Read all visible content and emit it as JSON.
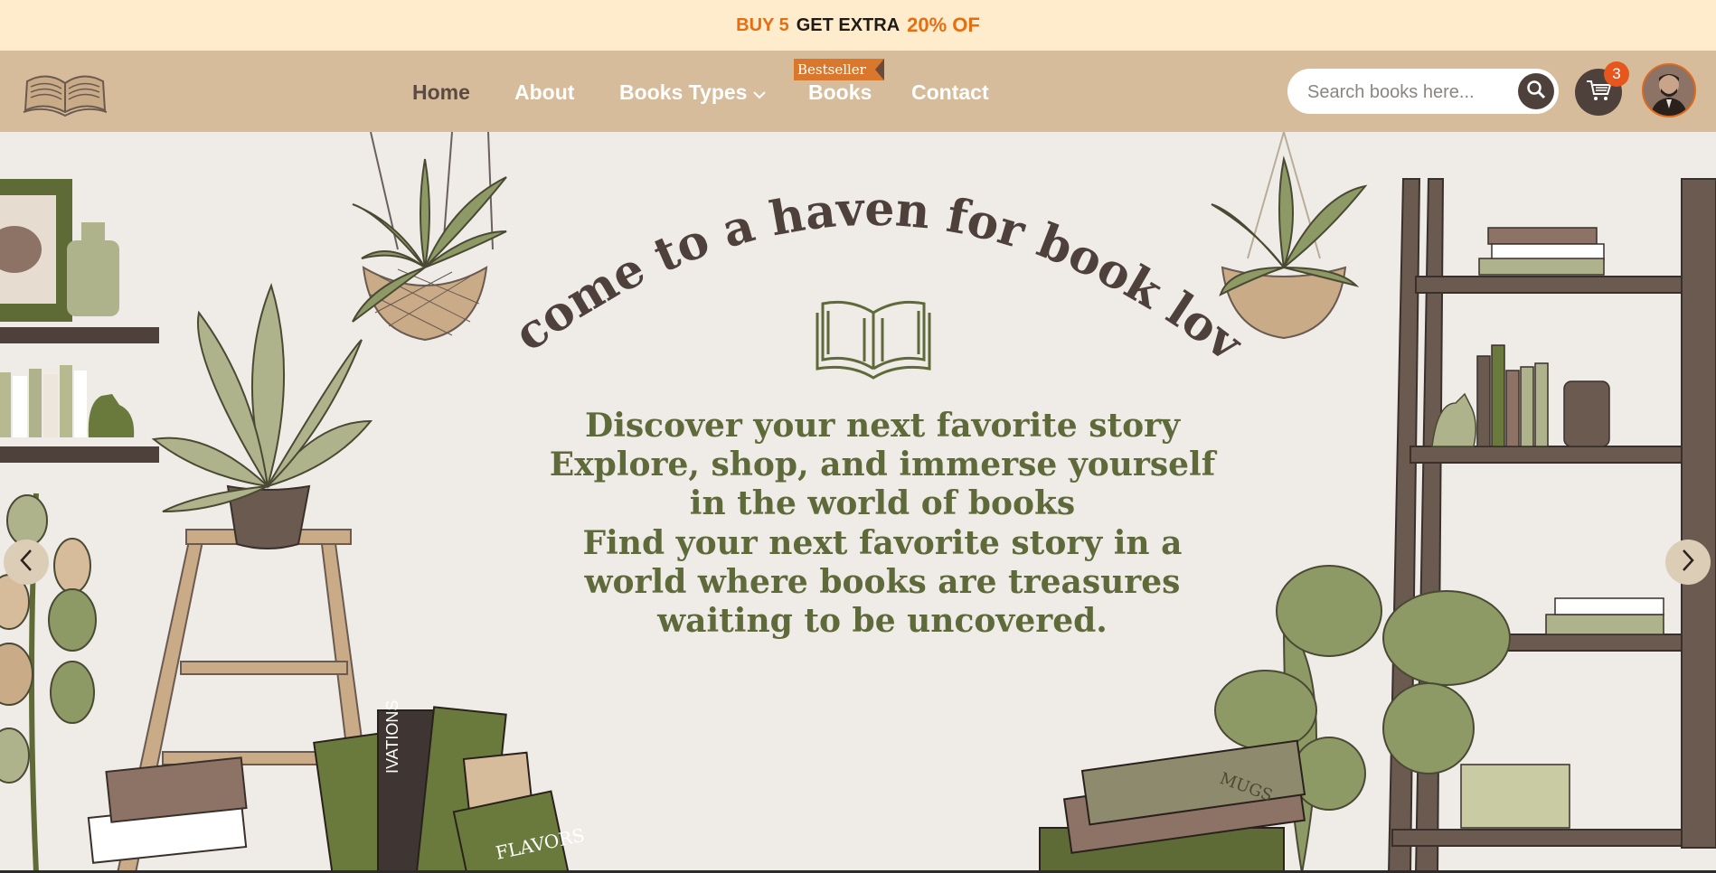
{
  "promo": {
    "part1": "BUY 5",
    "part2": "GET EXTRA",
    "part3": "20% OF"
  },
  "nav": {
    "items": [
      {
        "label": "Home"
      },
      {
        "label": "About"
      },
      {
        "label": "Books Types"
      },
      {
        "label": "Books"
      },
      {
        "label": "Contact"
      }
    ],
    "badge": "Bestseller"
  },
  "search": {
    "placeholder": "Search books here..."
  },
  "cart": {
    "count": "3"
  },
  "hero": {
    "heading": "Welcome to a haven for book lovers",
    "tagline": "Discover your next favorite story Explore, shop, and immerse yourself in the world of books",
    "tagline2": "Find your next favorite story in a world where books are treasures waiting to be uncovered.",
    "book_spine_label": "IVATIONS",
    "book_cover_label": "FLAVORS",
    "mugs_label": "MUGS"
  },
  "colors": {
    "promo_bg": "#feeccc",
    "header_bg": "#d6bc9b",
    "accent_orange": "#e66e12",
    "hero_text": "#5f6a3a",
    "heading_text": "#4e413c"
  },
  "icons": [
    "open-book-logo-icon",
    "chevron-down-icon",
    "search-icon",
    "cart-icon",
    "chevron-left-icon",
    "chevron-right-icon"
  ]
}
